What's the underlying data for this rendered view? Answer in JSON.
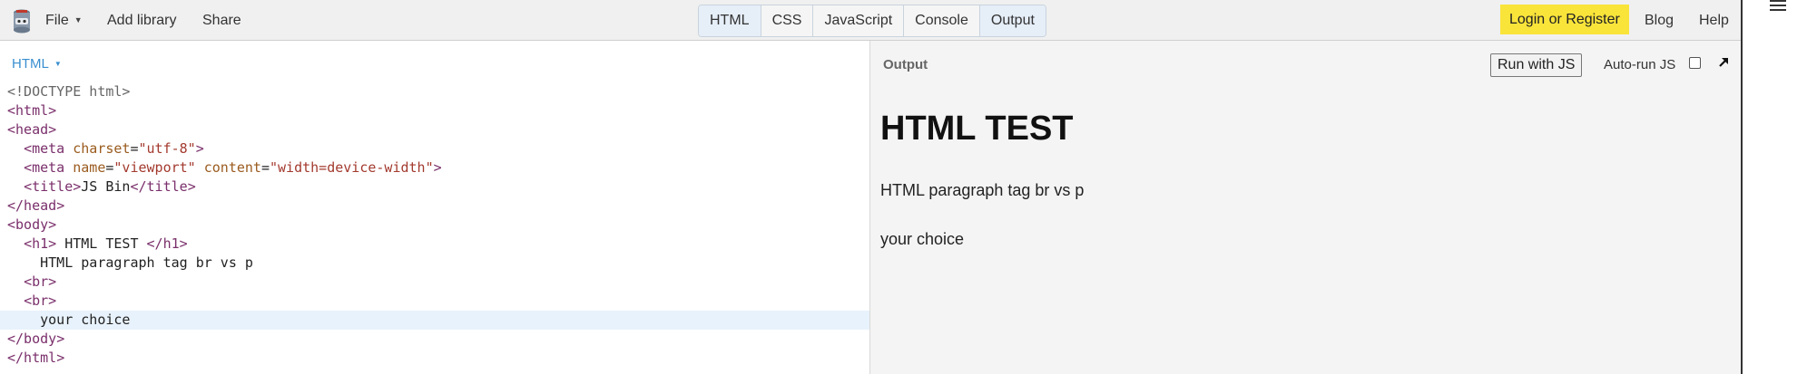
{
  "toolbar": {
    "file_label": "File",
    "add_library_label": "Add library",
    "share_label": "Share",
    "panel_tabs": [
      {
        "label": "HTML",
        "active": true
      },
      {
        "label": "CSS",
        "active": false
      },
      {
        "label": "JavaScript",
        "active": false
      },
      {
        "label": "Console",
        "active": false
      },
      {
        "label": "Output",
        "active": true
      }
    ],
    "login_label": "Login or Register",
    "blog_label": "Blog",
    "help_label": "Help",
    "accent_color": "#f9e43a"
  },
  "editor": {
    "panel_label": "HTML",
    "code_lines": [
      "<!DOCTYPE html>",
      "<html>",
      "<head>",
      "  <meta charset=\"utf-8\">",
      "  <meta name=\"viewport\" content=\"width=device-width\">",
      "  <title>JS Bin</title>",
      "</head>",
      "<body>",
      "  <h1> HTML TEST </h1>",
      "    HTML paragraph tag br vs p",
      "  <br>",
      "  <br>",
      "    your choice",
      "</body>",
      "</html>"
    ]
  },
  "output": {
    "panel_label": "Output",
    "run_button_label": "Run with JS",
    "autorun_label": "Auto-run JS",
    "autorun_checked": false,
    "heading": "HTML TEST",
    "paragraph_1": "HTML paragraph tag br vs p",
    "paragraph_2": "your choice"
  },
  "icons": {
    "logo": "jsbin-logo-icon",
    "popout": "popout-arrow-icon",
    "menu": "hamburger-menu-icon"
  }
}
